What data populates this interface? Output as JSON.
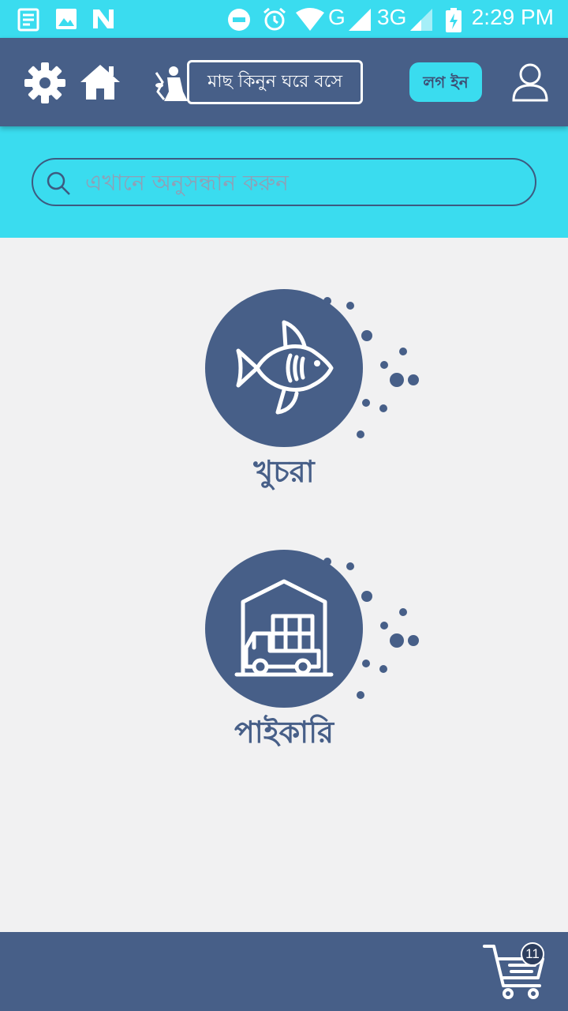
{
  "status_bar": {
    "time": "2:29 PM",
    "network_g": "G",
    "network_3g": "3G",
    "icons": [
      "news-icon",
      "image-icon",
      "n-app-icon",
      "do-not-disturb-icon",
      "alarm-icon",
      "wifi-icon",
      "signal-icon",
      "battery-icon"
    ]
  },
  "header": {
    "brand_text": "মাছ কিনুন ঘরে বসে",
    "login_label": "লগ ইন",
    "icons": [
      "settings-icon",
      "home-icon",
      "fisherman-logo-icon",
      "user-icon"
    ]
  },
  "search": {
    "placeholder": "এখানে অনুসন্ধান করুন",
    "value": ""
  },
  "categories": [
    {
      "label": "খুচরা",
      "icon": "fish-icon"
    },
    {
      "label": "পাইকারি",
      "icon": "warehouse-truck-icon"
    }
  ],
  "bottom_bar": {
    "cart_count": "11",
    "icon": "cart-icon"
  },
  "colors": {
    "accent_cyan": "#3adcef",
    "primary_navy": "#475f88",
    "background": "#f1f1f2"
  }
}
